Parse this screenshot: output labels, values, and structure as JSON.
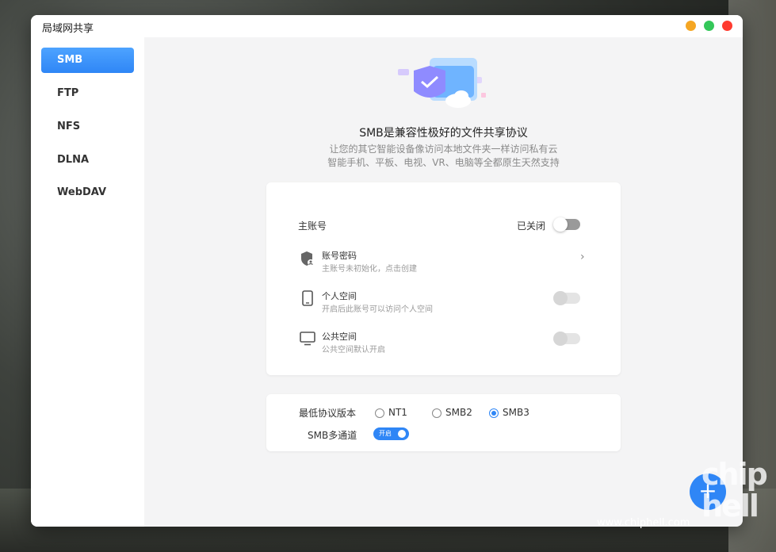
{
  "window": {
    "title": "局域网共享"
  },
  "sidebar": {
    "items": [
      {
        "label": "SMB"
      },
      {
        "label": "FTP"
      },
      {
        "label": "NFS"
      },
      {
        "label": "DLNA"
      },
      {
        "label": "WebDAV"
      }
    ]
  },
  "header": {
    "title": "SMB是兼容性极好的文件共享协议",
    "subtitle1": "让您的其它智能设备像访问本地文件夹一样访问私有云",
    "subtitle2": "智能手机、平板、电视、VR、电脑等全都原生天然支持"
  },
  "account": {
    "label": "主账号",
    "status": "已关闭",
    "password": {
      "label": "账号密码",
      "sub": "主账号未初始化，点击创建"
    },
    "personal": {
      "label": "个人空间",
      "sub": "开启后此账号可以访问个人空间"
    },
    "public": {
      "label": "公共空间",
      "sub": "公共空间默认开启"
    }
  },
  "protocol": {
    "min_version_label": "最低协议版本",
    "options": [
      "NT1",
      "SMB2",
      "SMB3"
    ],
    "selected": "SMB3",
    "multichannel_label": "SMB多通道",
    "multichannel_state": "开启"
  },
  "watermark": {
    "url": "www.chiphell.com",
    "logo": "chip hell"
  },
  "colors": {
    "accent": "#2f86f6",
    "close": "#ff3b30",
    "minimize": "#f5a623",
    "maximize": "#34c759"
  }
}
